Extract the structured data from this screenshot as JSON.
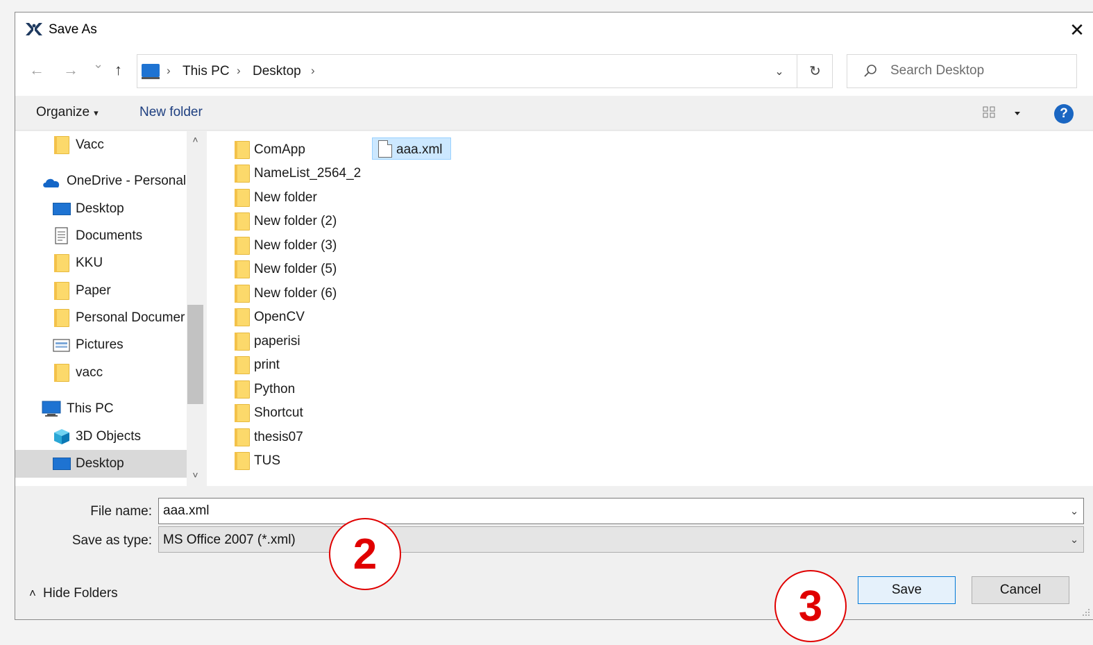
{
  "window": {
    "title": "Save As",
    "close_glyph": "✕"
  },
  "nav": {
    "back_glyph": "←",
    "forward_glyph": "→",
    "recent_glyph": "⌄",
    "up_glyph": "↑",
    "breadcrumbs": [
      "This PC",
      "Desktop"
    ],
    "sep_glyph": "›",
    "dropdown_glyph": "⌄",
    "refresh_glyph": "↻",
    "search_placeholder": "Search Desktop"
  },
  "toolbar": {
    "organize_label": "Organize",
    "caret_glyph": "▾",
    "new_folder_label": "New folder",
    "help_glyph": "?"
  },
  "sidebar": {
    "scroll_up_glyph": "˄",
    "scroll_down_glyph": "˅",
    "items": [
      {
        "label": "Vacc",
        "icon": "folder-icon"
      },
      {
        "label": "OneDrive - Personal",
        "icon": "cloud-icon"
      },
      {
        "label": "Desktop",
        "icon": "desktop-icon"
      },
      {
        "label": "Documents",
        "icon": "documents-icon"
      },
      {
        "label": "KKU",
        "icon": "folder-icon"
      },
      {
        "label": "Paper",
        "icon": "folder-icon"
      },
      {
        "label": "Personal Documer",
        "icon": "folder-icon"
      },
      {
        "label": "Pictures",
        "icon": "pictures-icon"
      },
      {
        "label": "vacc",
        "icon": "folder-icon"
      },
      {
        "label": "This PC",
        "icon": "pc-icon"
      },
      {
        "label": "3D Objects",
        "icon": "cube-icon"
      },
      {
        "label": "Desktop",
        "icon": "desktop-icon"
      }
    ]
  },
  "files": {
    "folders": [
      "ComApp",
      "NameList_2564_2",
      "New folder",
      "New folder (2)",
      "New folder (3)",
      "New folder (5)",
      "New folder (6)",
      "OpenCV",
      "paperisi",
      "print",
      "Python",
      "Shortcut",
      "thesis07",
      "TUS"
    ],
    "documents": [
      "aaa.xml"
    ]
  },
  "form": {
    "file_name_label": "File name:",
    "file_name_value": "aaa.xml",
    "save_type_label": "Save as type:",
    "save_type_value": "MS Office 2007 (*.xml)",
    "dropdown_glyph": "⌄"
  },
  "footer": {
    "hide_folders_label": "Hide Folders",
    "hide_glyph": "˄",
    "save_label": "Save",
    "cancel_label": "Cancel"
  },
  "annotations": {
    "marker_2": "2",
    "marker_3": "3"
  },
  "colors": {
    "accent": "#0078d7",
    "annotation": "#e00000",
    "folder": "#fcd96b"
  }
}
